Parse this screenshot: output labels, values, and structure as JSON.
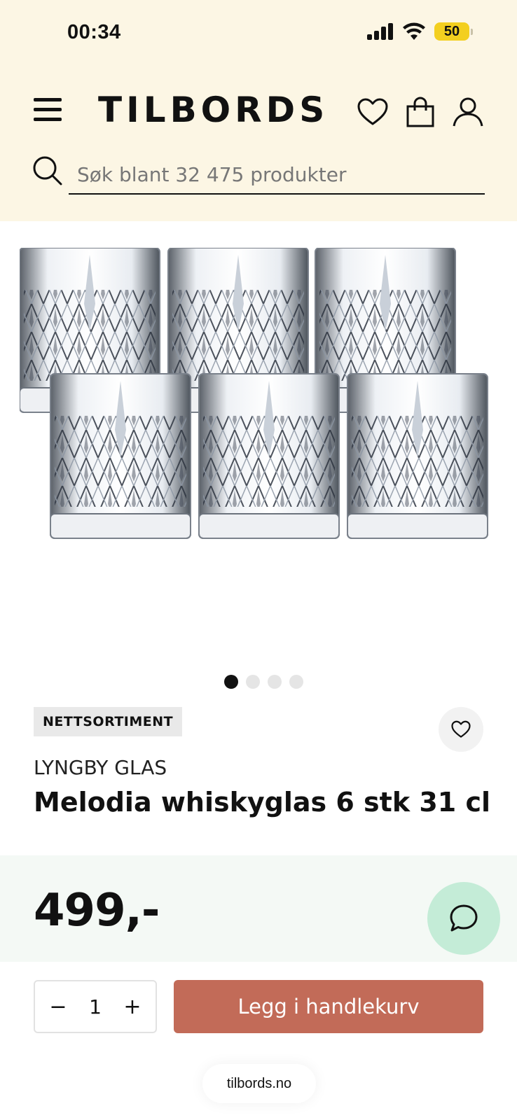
{
  "status_bar": {
    "time": "00:34",
    "battery": "50"
  },
  "header": {
    "logo": "TILBORDS",
    "search_placeholder": "Søk blant 32 475 produkter"
  },
  "gallery": {
    "image_alt": "Melodia whiskyglas 6 stk",
    "slide_count": 4,
    "active_index": 0
  },
  "product": {
    "badge": "NETTSORTIMENT",
    "brand": "LYNGBY GLAS",
    "title": "Melodia whiskyglas 6 stk 31 cl",
    "price": "499,-"
  },
  "cart": {
    "quantity": "1",
    "minus_label": "−",
    "plus_label": "+",
    "add_to_cart": "Legg i handlekurv"
  },
  "browser": {
    "url": "tilbords.no"
  },
  "colors": {
    "header_bg": "#fcf6e4",
    "price_bg": "#f4f9f5",
    "cta": "#c26b58",
    "chat": "#c4ecd7",
    "battery": "#f3cf1f"
  }
}
